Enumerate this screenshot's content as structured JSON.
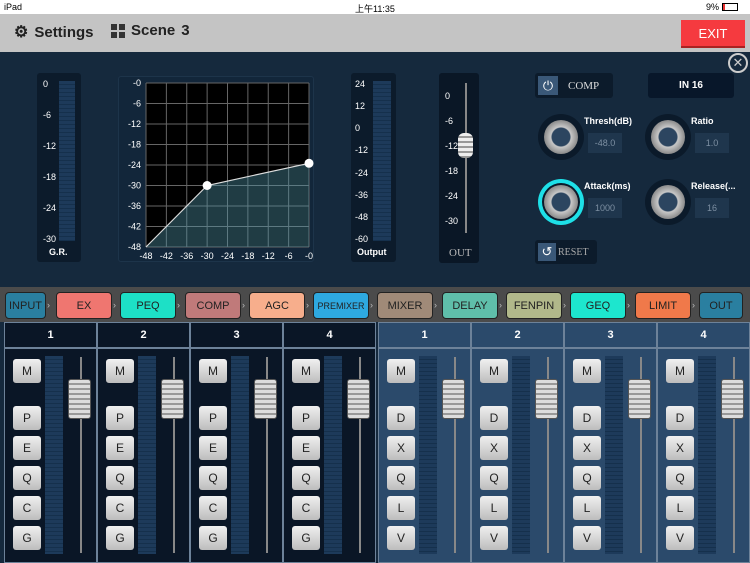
{
  "status": {
    "device": "iPad",
    "time": "上午11:35",
    "battery": "9%"
  },
  "header": {
    "settings_label": "Settings",
    "scene_label": "Scene",
    "scene_number": "3",
    "exit_label": "EXIT"
  },
  "comp": {
    "gr_meter": {
      "ticks": [
        "0",
        "-6",
        "-12",
        "-18",
        "-24",
        "-30"
      ],
      "label": "G.R."
    },
    "output_meter": {
      "ticks": [
        "24",
        "12",
        "0",
        "-12",
        "-24",
        "-36",
        "-48",
        "-60"
      ],
      "label": "Output"
    },
    "out_fader": {
      "ticks": [
        "0",
        "-6",
        "-12",
        "-18",
        "-24",
        "-30"
      ],
      "label": "OUT",
      "value_db": -12
    },
    "graph": {
      "x_ticks": [
        "-48",
        "-42",
        "-36",
        "-30",
        "-24",
        "-18",
        "-12",
        "-6",
        "-0"
      ],
      "y_ticks": [
        "-0",
        "-6",
        "-12",
        "-18",
        "-24",
        "-30",
        "-36",
        "-42",
        "-48"
      ],
      "range": [
        -48,
        0
      ],
      "curve": [
        [
          -48,
          -48
        ],
        [
          -30,
          -30
        ],
        [
          0,
          -23.5
        ]
      ]
    },
    "power_label": "COMP",
    "channel_label": "IN 16",
    "reset_label": "RESET",
    "knobs": [
      {
        "label": "Thresh(dB)",
        "value": "-48.0",
        "active": false
      },
      {
        "label": "Ratio",
        "value": "1.0",
        "active": false
      },
      {
        "label": "Attack(ms)",
        "value": "1000",
        "active": true
      },
      {
        "label": "Release(...",
        "value": "16",
        "active": false
      }
    ],
    "accent": "#1ee0e8"
  },
  "modules": [
    {
      "label": "INPUT",
      "color": "#2a7fa0"
    },
    {
      "label": "EX",
      "color": "#ef7670"
    },
    {
      "label": "PEQ",
      "color": "#1de0c6"
    },
    {
      "label": "COMP",
      "color": "#c07a7a"
    },
    {
      "label": "AGC",
      "color": "#f7ae8c"
    },
    {
      "label": "PREMIXER",
      "color": "#2ea9e0"
    },
    {
      "label": "MIXER",
      "color": "#a08a78"
    },
    {
      "label": "DELAY",
      "color": "#5fbfaa"
    },
    {
      "label": "FENPIN",
      "color": "#b1b88a"
    },
    {
      "label": "GEQ",
      "color": "#1de6ce"
    },
    {
      "label": "LIMIT",
      "color": "#f0794a"
    },
    {
      "label": "OUT",
      "color": "#2a7fa0"
    }
  ],
  "inputs": [
    {
      "name": "1",
      "buttons": [
        "M",
        "P",
        "E",
        "Q",
        "C",
        "G"
      ]
    },
    {
      "name": "2",
      "buttons": [
        "M",
        "P",
        "E",
        "Q",
        "C",
        "G"
      ]
    },
    {
      "name": "3",
      "buttons": [
        "M",
        "P",
        "E",
        "Q",
        "C",
        "G"
      ]
    },
    {
      "name": "4",
      "buttons": [
        "M",
        "P",
        "E",
        "Q",
        "C",
        "G"
      ]
    }
  ],
  "outputs": [
    {
      "name": "1",
      "buttons": [
        "M",
        "D",
        "X",
        "Q",
        "L",
        "V"
      ]
    },
    {
      "name": "2",
      "buttons": [
        "M",
        "D",
        "X",
        "Q",
        "L",
        "V"
      ]
    },
    {
      "name": "3",
      "buttons": [
        "M",
        "D",
        "X",
        "Q",
        "L",
        "V"
      ]
    },
    {
      "name": "4",
      "buttons": [
        "M",
        "D",
        "X",
        "Q",
        "L",
        "V"
      ]
    }
  ]
}
